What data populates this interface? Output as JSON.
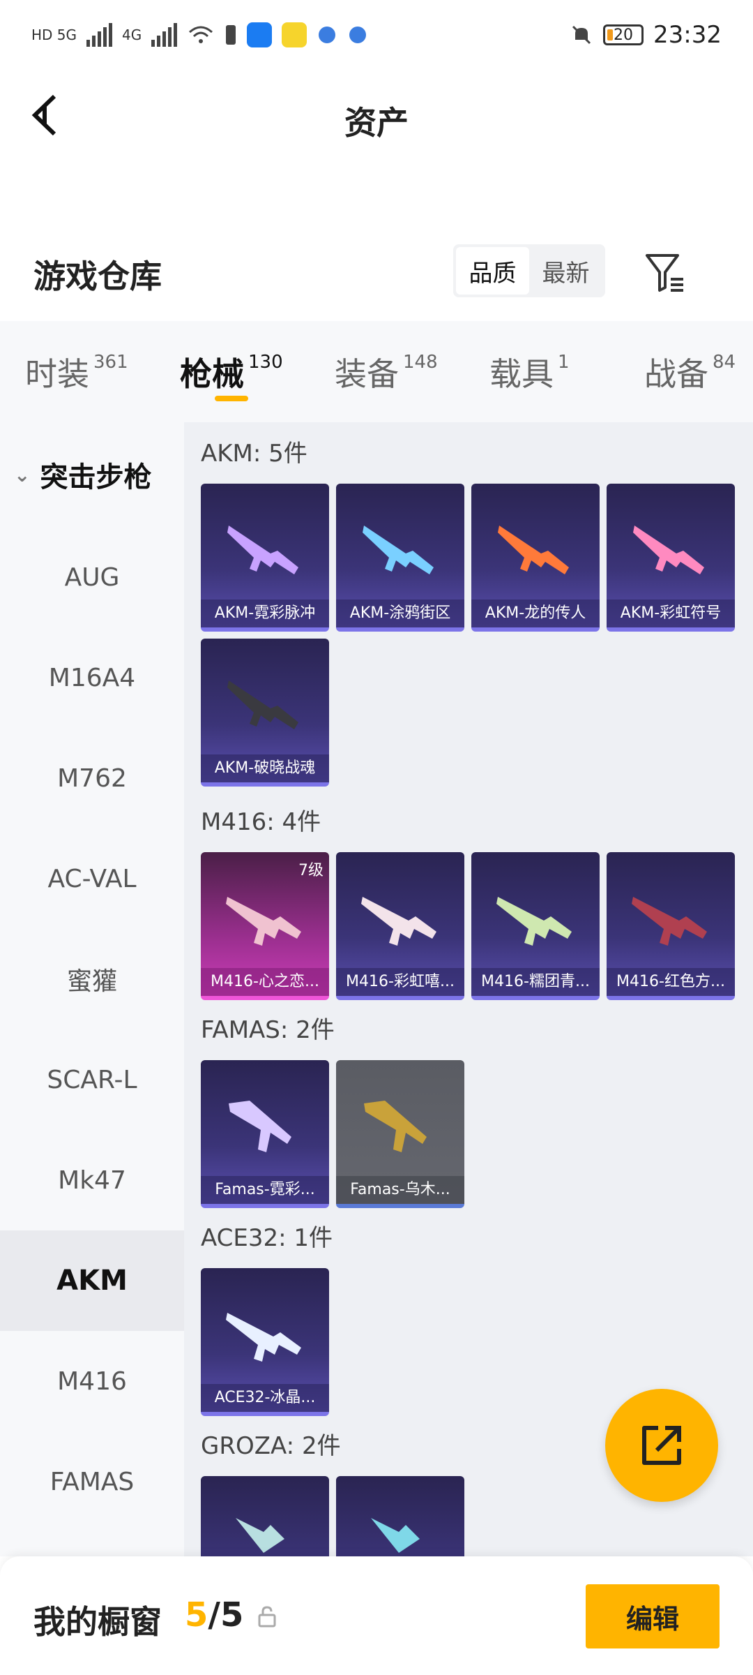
{
  "status": {
    "network_left": "HD 5G",
    "network_right": "4G",
    "battery": "20",
    "time": "23:32"
  },
  "header": {
    "back_icon": "back-arrow-icon",
    "title": "资产"
  },
  "warehouse": {
    "title": "游戏仓库",
    "sort_options": [
      "品质",
      "最新"
    ],
    "active_sort": "品质",
    "filter_icon": "filter-icon"
  },
  "tabs": [
    {
      "label": "时装",
      "count": "361"
    },
    {
      "label": "枪械",
      "count": "130"
    },
    {
      "label": "装备",
      "count": "148"
    },
    {
      "label": "载具",
      "count": "1"
    },
    {
      "label": "战备",
      "count": "84"
    }
  ],
  "sidebar": {
    "group": "突击步枪",
    "items": [
      "AUG",
      "M16A4",
      "M762",
      "AC-VAL",
      "蜜獾",
      "SCAR-L",
      "Mk47",
      "AKM",
      "M416",
      "FAMAS"
    ],
    "active": "AKM"
  },
  "categories": [
    {
      "title": "AKM: 5件",
      "items": [
        {
          "label": "AKM-霓彩脉冲"
        },
        {
          "label": "AKM-涂鸦街区"
        },
        {
          "label": "AKM-龙的传人"
        },
        {
          "label": "AKM-彩虹符号"
        },
        {
          "label": "AKM-破晓战魂"
        }
      ]
    },
    {
      "title": "M416: 4件",
      "items": [
        {
          "label": "M416-心之恋...",
          "level": "7级"
        },
        {
          "label": "M416-彩虹嘻..."
        },
        {
          "label": "M416-糯团青..."
        },
        {
          "label": "M416-红色方..."
        }
      ]
    },
    {
      "title": "FAMAS: 2件",
      "items": [
        {
          "label": "Famas-霓彩..."
        },
        {
          "label": "Famas-乌木..."
        }
      ]
    },
    {
      "title": "ACE32: 1件",
      "items": [
        {
          "label": "ACE32-冰晶..."
        }
      ]
    },
    {
      "title": "GROZA: 2件",
      "items": [
        {
          "label": ""
        },
        {
          "label": ""
        }
      ]
    }
  ],
  "fab": {
    "icon": "share-out-icon"
  },
  "bottom": {
    "title": "我的橱窗",
    "count_current": "5",
    "count_total": "/5",
    "lock_icon": "lock-icon",
    "edit_label": "编辑"
  }
}
